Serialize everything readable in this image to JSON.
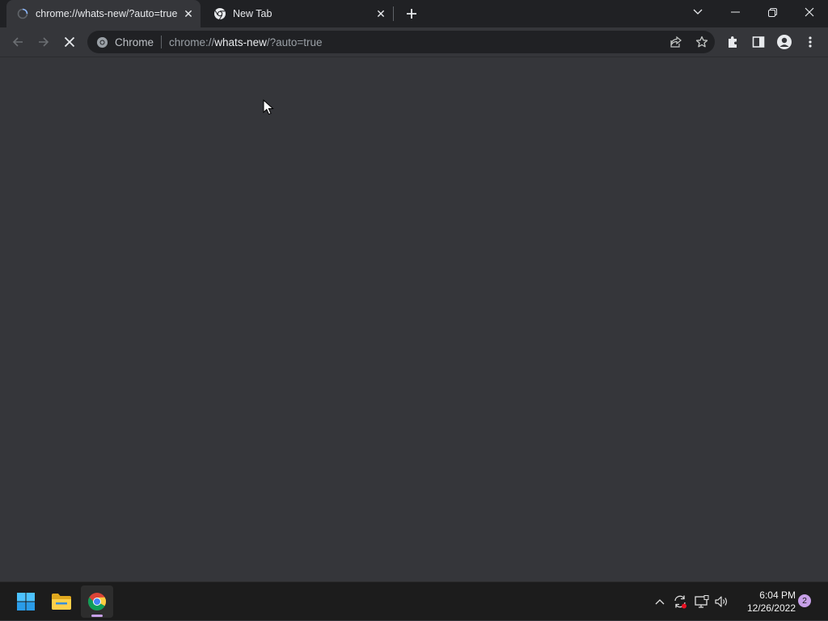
{
  "browser": {
    "tabs": [
      {
        "title": "chrome://whats-new/?auto=true",
        "loading": true,
        "active": true
      },
      {
        "title": "New Tab",
        "loading": false,
        "active": false
      }
    ],
    "omnibox": {
      "chip": "Chrome",
      "url_scheme": "chrome://",
      "url_host": "whats-new",
      "url_rest": "/?auto=true"
    },
    "content_background": "#35363a"
  },
  "taskbar": {
    "pinned": [
      "windows-start-icon",
      "file-explorer-icon",
      "chrome-icon"
    ],
    "clock": {
      "time": "6:04 PM",
      "date": "12/26/2022"
    },
    "notification_count": "2"
  },
  "colors": {
    "tabstrip": "#202124",
    "toolbar": "#35363a",
    "omnibox": "#202124",
    "accent": "#c7a0e8"
  }
}
